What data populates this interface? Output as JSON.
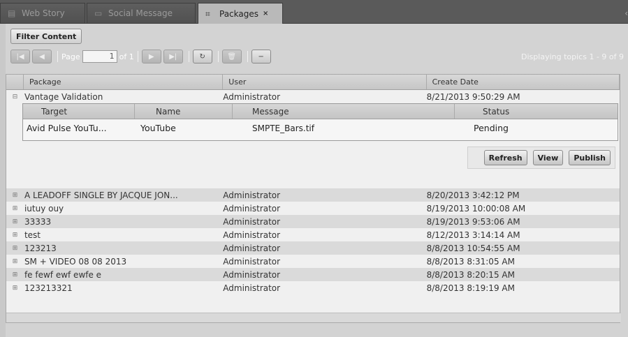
{
  "tabs": [
    {
      "label": "Web Story",
      "icon": "document-icon",
      "active": false
    },
    {
      "label": "Social Message",
      "icon": "chat-icon",
      "active": false
    },
    {
      "label": "Packages",
      "icon": "package-icon",
      "active": true
    }
  ],
  "tab_close": "×",
  "tab_edge": "‹",
  "toolbar": {
    "filter_label": "Filter Content",
    "page_label": "Page",
    "page_value": "1",
    "of_label": "of 1",
    "displaying": "Displaying topics 1 - 9 of 9"
  },
  "grid": {
    "columns": [
      "Package",
      "User",
      "Create Date"
    ],
    "expanded_row": {
      "package": "Vantage Validation",
      "user": "Administrator",
      "date": "8/21/2013 9:50:29 AM"
    },
    "sub_columns": [
      "Target",
      "Name",
      "Message",
      "Status"
    ],
    "sub_row": {
      "target": "Avid Pulse YouTu...",
      "name": "YouTube",
      "message": "SMPTE_Bars.tif",
      "status": "Pending"
    },
    "actions": {
      "refresh": "Refresh",
      "view": "View",
      "publish": "Publish"
    },
    "rows": [
      {
        "package": "A LEADOFF SINGLE BY JACQUE JON...",
        "user": "Administrator",
        "date": "8/20/2013 3:42:12 PM"
      },
      {
        "package": "iutuy ouy",
        "user": "Administrator",
        "date": "8/19/2013 10:00:08 AM"
      },
      {
        "package": "33333",
        "user": "Administrator",
        "date": "8/19/2013 9:53:06 AM"
      },
      {
        "package": "test",
        "user": "Administrator",
        "date": "8/12/2013 3:14:14 AM"
      },
      {
        "package": "123213",
        "user": "Administrator",
        "date": "8/8/2013 10:54:55 AM"
      },
      {
        "package": "SM + VIDEO 08 08 2013",
        "user": "Administrator",
        "date": "8/8/2013 8:31:05 AM"
      },
      {
        "package": "fe fewf ewf ewfe e",
        "user": "Administrator",
        "date": "8/8/2013 8:20:15 AM"
      },
      {
        "package": "123213321",
        "user": "Administrator",
        "date": "8/8/2013 8:19:19 AM"
      }
    ]
  },
  "icons": {
    "collapse": "⊟",
    "expand": "⊞"
  }
}
